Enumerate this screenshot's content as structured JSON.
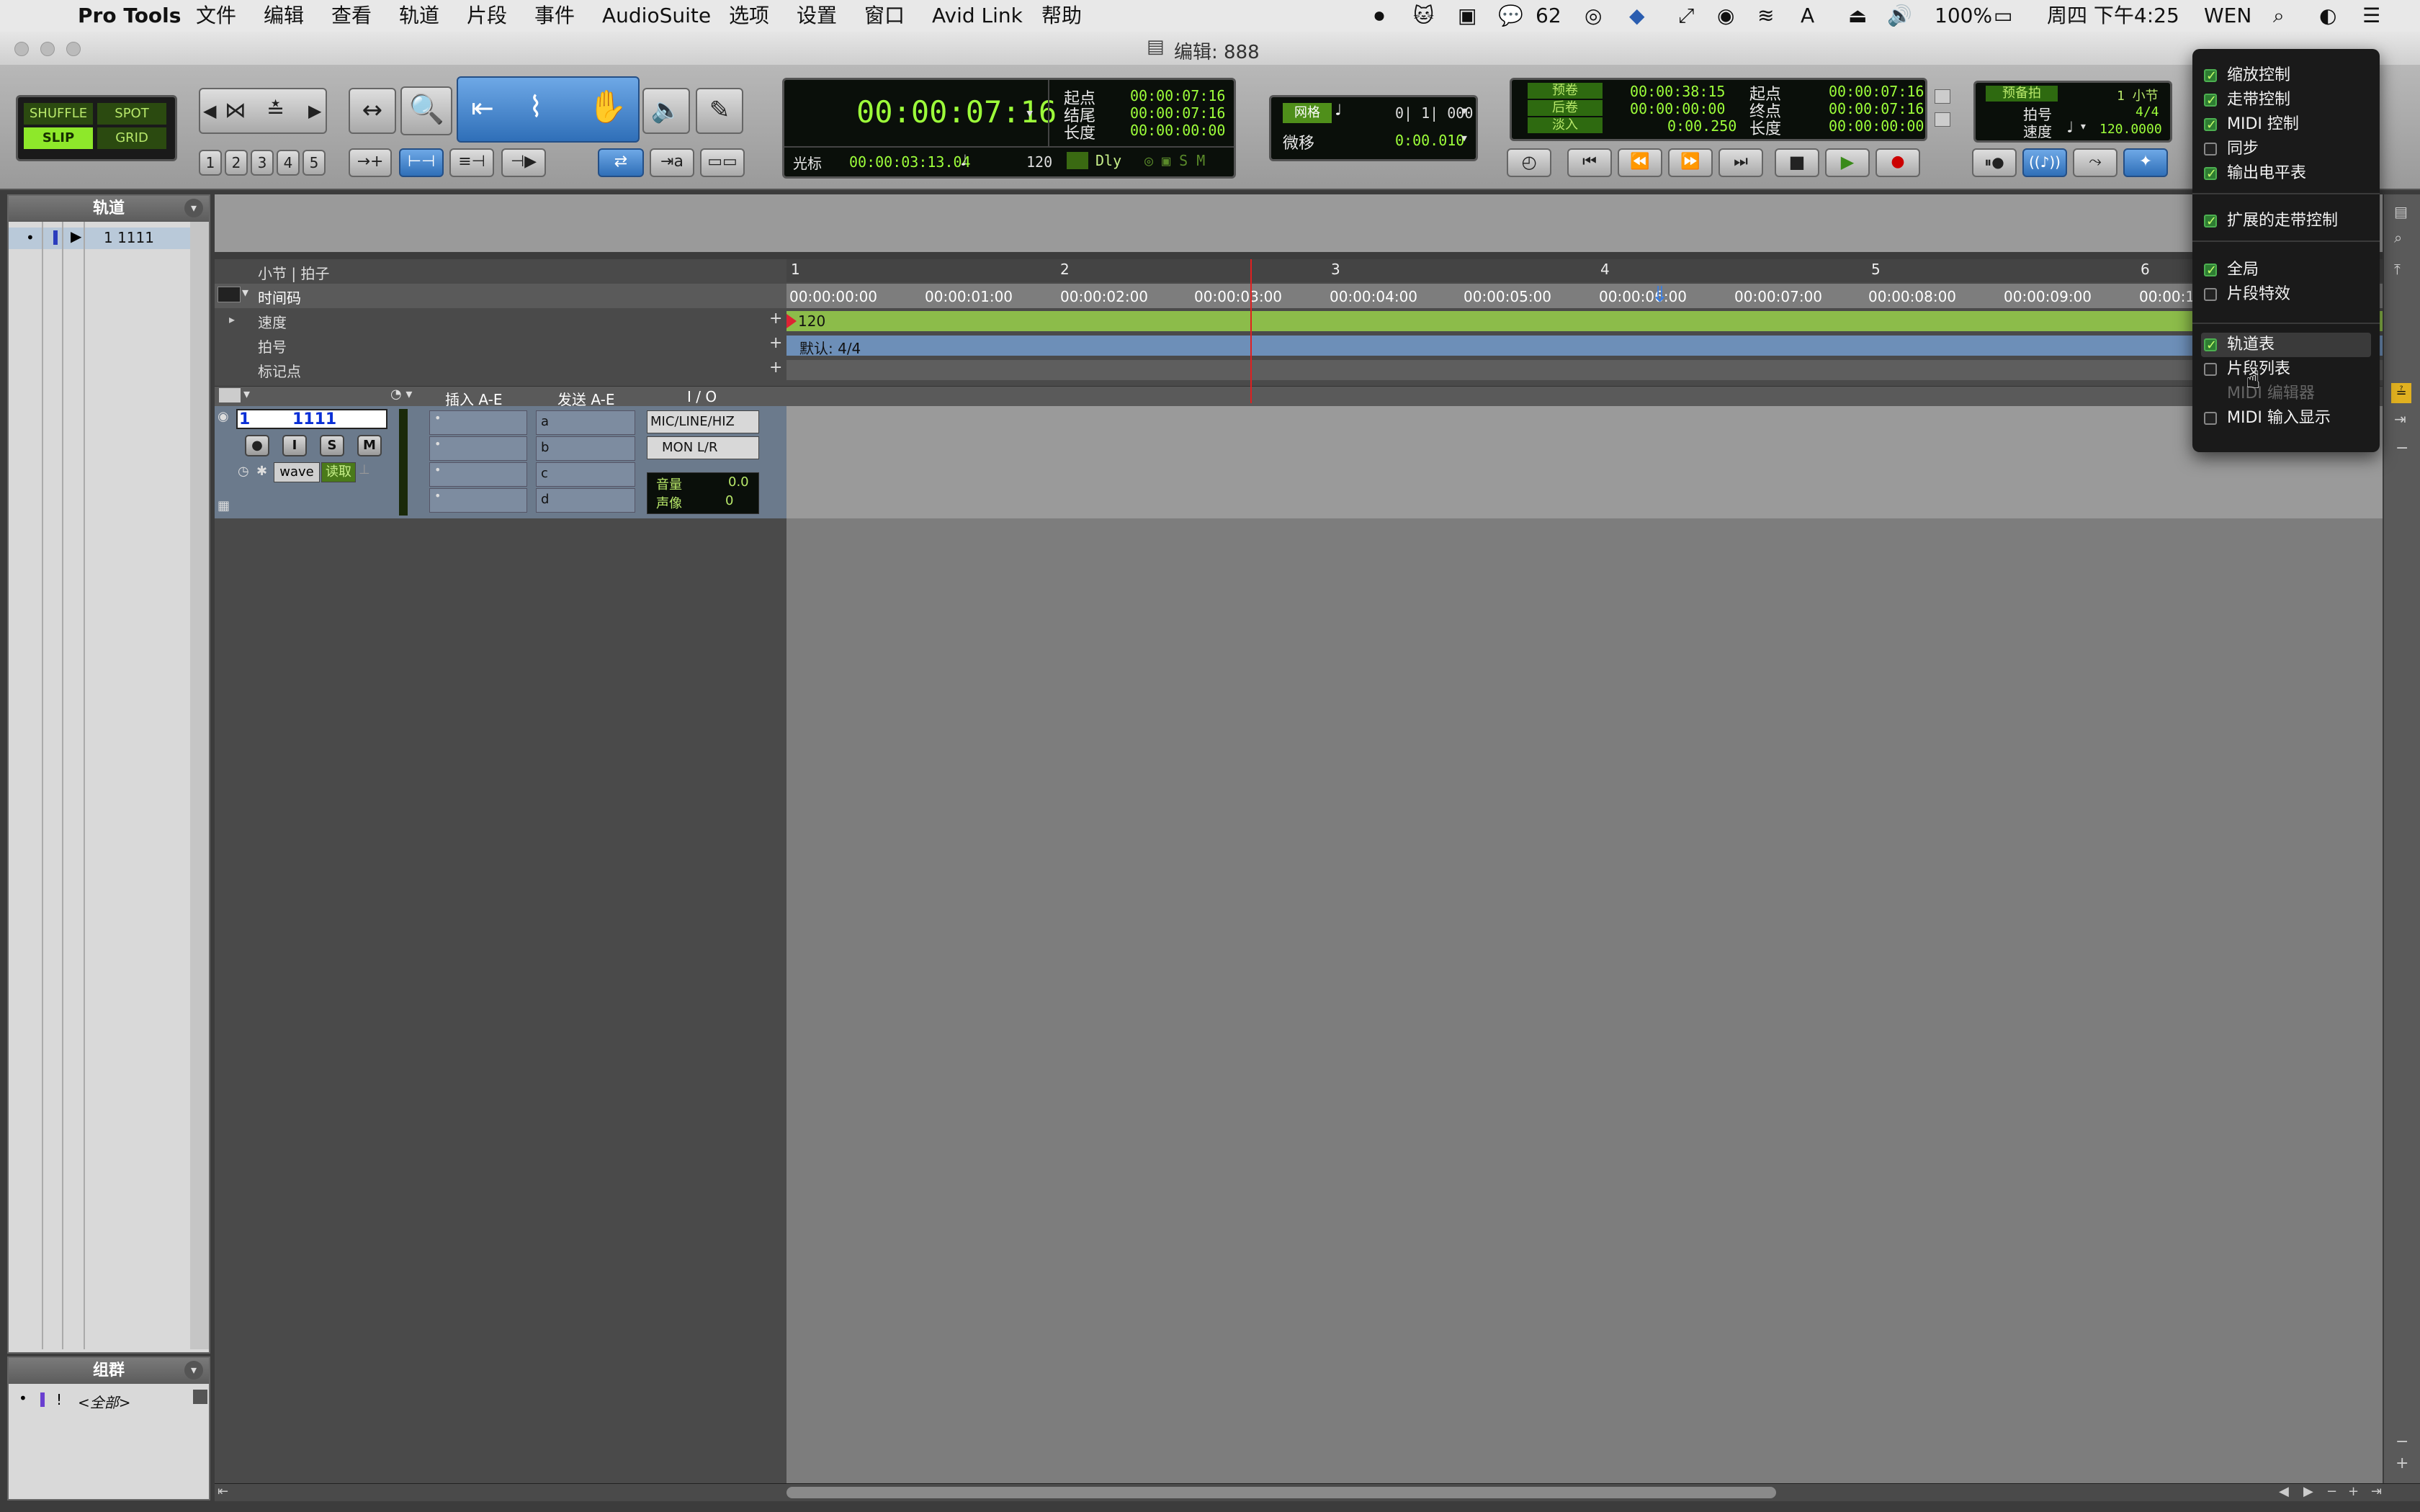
{
  "menubar": {
    "app_name": "Pro Tools",
    "menus": [
      "文件",
      "编辑",
      "查看",
      "轨道",
      "片段",
      "事件",
      "AudioSuite",
      "选项",
      "设置",
      "窗口",
      "Avid Link",
      "帮助"
    ],
    "status": {
      "wechat_count": "62",
      "battery": "100%",
      "clock": "周四 下午4:25",
      "user": "WEN"
    }
  },
  "window": {
    "title": "编辑: 888"
  },
  "edit_modes": {
    "shuffle": "SHUFFLE",
    "spot": "SPOT",
    "slip": "SLIP",
    "grid": "GRID"
  },
  "zoom_presets": [
    "1",
    "2",
    "3",
    "4",
    "5"
  ],
  "main_counter": {
    "value": "00:00:07:16",
    "start_label": "起点",
    "end_label": "结尾",
    "length_label": "长度",
    "start": "00:00:07:16",
    "end": "00:00:07:16",
    "length": "00:00:00:00",
    "cursor_label": "光标",
    "cursor": "00:00:03:13.04",
    "tempo": "120",
    "dly_label": "Dly"
  },
  "grid_nudge": {
    "grid_label": "网格",
    "grid_value": "0| 1| 000",
    "nudge_label": "微移",
    "nudge_value": "0:00.010"
  },
  "transport_counters": {
    "preroll_label": "预卷",
    "preroll": "00:00:38:15",
    "postroll_label": "后卷",
    "postroll": "00:00:00:00",
    "fadein_label": "淡入",
    "fadein": "0:00.250",
    "start_label": "起点",
    "start": "00:00:07:16",
    "end_label": "终点",
    "end": "00:00:07:16",
    "length_label": "长度",
    "length": "00:00:00:00"
  },
  "tempo_panel": {
    "countoff_label": "预备拍",
    "countoff_value": "1 小节",
    "meter_label": "拍号",
    "meter_value": "4/4",
    "tempo_label": "速度",
    "tempo_value": "120.0000"
  },
  "tracks_panel": {
    "header": "轨道",
    "items": [
      {
        "name": "1 1111"
      }
    ]
  },
  "groups_panel": {
    "header": "组群",
    "items": [
      {
        "name": "<全部>"
      }
    ]
  },
  "rulers": {
    "bars_beats_label": "小节 | 拍子",
    "bars": [
      "1",
      "2",
      "3",
      "4",
      "5",
      "6"
    ],
    "timecode_label": "时间码",
    "timecodes": [
      "00:00:00:00",
      "00:00:01:00",
      "00:00:02:00",
      "00:00:03:00",
      "00:00:04:00",
      "00:00:05:00",
      "00:00:06:00",
      "00:00:07:00",
      "00:00:08:00",
      "00:00:09:00",
      "00:00:1"
    ],
    "tempo_label": "速度",
    "tempo_marker": "120",
    "meter_label": "拍号",
    "meter_marker": "默认: 4/4",
    "markers_label": "标记点"
  },
  "column_headers": {
    "inserts": "插入 A-E",
    "sends": "发送 A-E",
    "io": "I / O"
  },
  "track": {
    "number": "1",
    "name": "1111",
    "rec": "●",
    "input": "I",
    "solo": "S",
    "mute": "M",
    "view": "wave",
    "automation": "读取",
    "sends": [
      "a",
      "b",
      "c",
      "d"
    ],
    "input_assign": "MIC/LINE/HIZ",
    "output_assign": "MON L/R",
    "volume_label": "音量",
    "volume": "0.0",
    "pan_label": "声像",
    "pan": "0"
  },
  "view_menu": {
    "items": [
      {
        "label": "缩放控制",
        "checked": true
      },
      {
        "label": "走带控制",
        "checked": true
      },
      {
        "label": "MIDI 控制",
        "checked": true
      },
      {
        "label": "同步",
        "checked": false
      },
      {
        "label": "输出电平表",
        "checked": true
      },
      {
        "label": "扩展的走带控制",
        "checked": true
      },
      {
        "label": "全局",
        "checked": true
      },
      {
        "label": "片段特效",
        "checked": false
      },
      {
        "label": "轨道表",
        "checked": true
      },
      {
        "label": "片段列表",
        "checked": false
      },
      {
        "label": "MIDI 编辑器",
        "checked": false,
        "disabled": true
      },
      {
        "label": "MIDI 输入显示",
        "checked": false
      }
    ]
  }
}
